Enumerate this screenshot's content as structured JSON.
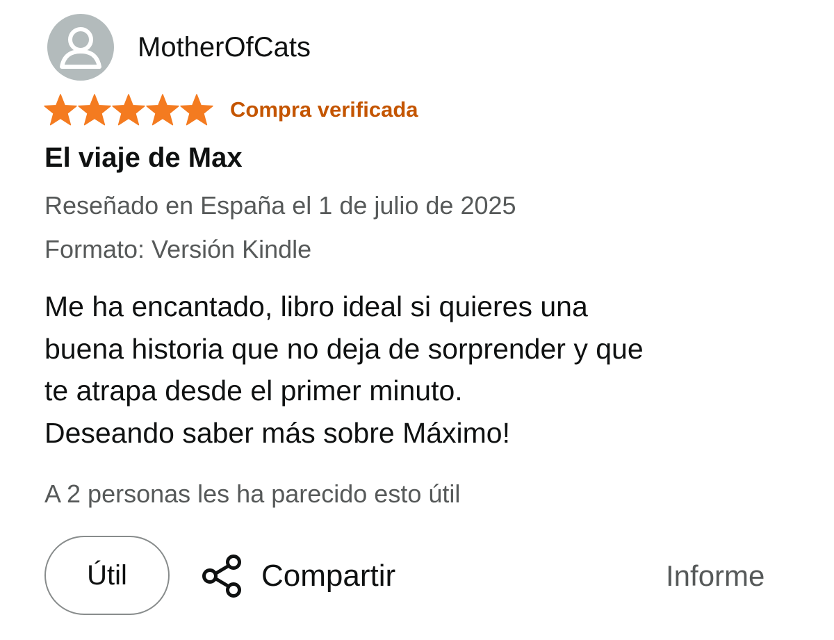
{
  "review": {
    "author": {
      "name": "MotherOfCats",
      "avatar_icon": "user-silhouette-icon"
    },
    "rating": {
      "value": 5,
      "max": 5,
      "star_color": "#f47b20",
      "verified_label": "Compra verificada",
      "verified_color": "#c45500"
    },
    "title": "El viaje de Max",
    "date_text": "Reseñado en España el 1 de julio de 2025",
    "format_text": "Formato: Versión Kindle",
    "body_lines": [
      "Me ha encantado, libro ideal si quieres una",
      "buena historia que no deja de sorprender y que",
      "te atrapa desde el primer minuto.",
      "Deseando saber más sobre Máximo!"
    ],
    "helpful_count_text": "A 2 personas les ha parecido esto útil"
  },
  "actions": {
    "useful_label": "Útil",
    "share_label": "Compartir",
    "share_icon": "share-icon",
    "report_label": "Informe"
  }
}
